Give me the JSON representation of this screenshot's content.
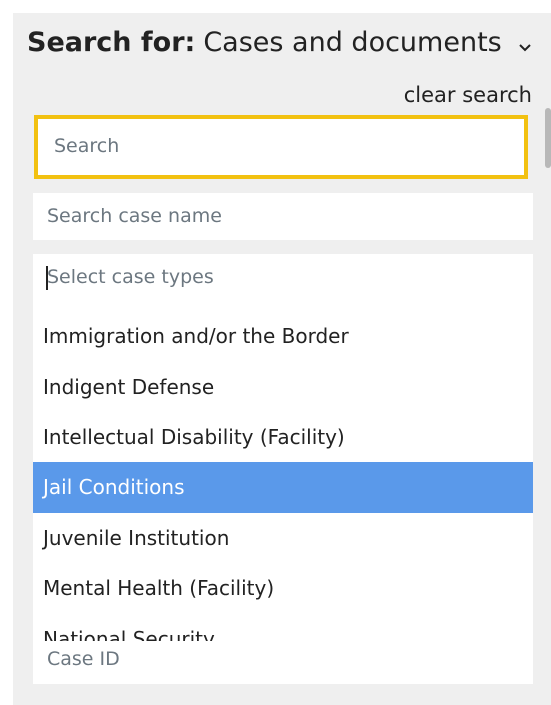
{
  "header": {
    "label": "Search for:",
    "value": "Cases and documents"
  },
  "clear_search": "clear search",
  "search": {
    "placeholder": "Search"
  },
  "case_name": {
    "placeholder": "Search case name"
  },
  "case_types": {
    "placeholder": "Select case types",
    "options": [
      "Immigration and/or the Border",
      "Indigent Defense",
      "Intellectual Disability (Facility)",
      "Jail Conditions",
      "Juvenile Institution",
      "Mental Health (Facility)",
      "National Security"
    ],
    "highlighted": "Jail Conditions"
  },
  "case_id": {
    "placeholder": "Case ID"
  },
  "colors": {
    "focus_border": "#f2c111",
    "highlight": "#5a99ea"
  },
  "icons": {
    "dropdown": "chevron-down-icon"
  }
}
